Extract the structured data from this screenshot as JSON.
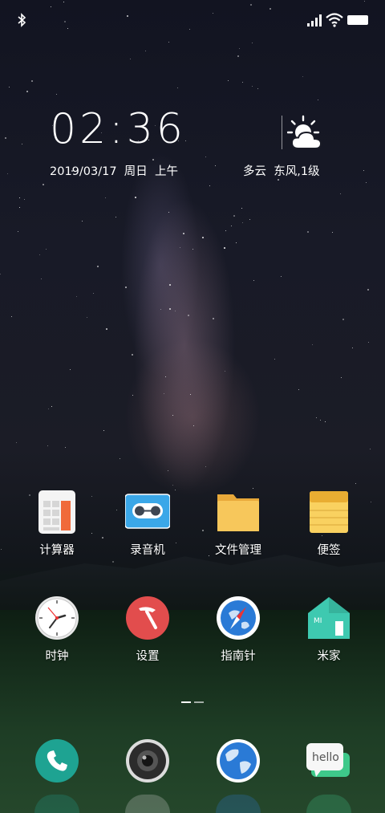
{
  "status_bar": {
    "bluetooth_icon": "bluetooth-icon",
    "signal_icon": "cell-signal-icon",
    "wifi_icon": "wifi-icon",
    "battery_icon": "battery-icon"
  },
  "clock_widget": {
    "time": "02:36",
    "date": "2019/03/17  周日  上午",
    "weather": "多云  东风,1级",
    "weather_icon": "partly-cloudy-icon"
  },
  "apps_row1": [
    {
      "label": "计算器",
      "icon": "calculator-icon"
    },
    {
      "label": "录音机",
      "icon": "recorder-icon"
    },
    {
      "label": "文件管理",
      "icon": "folder-icon"
    },
    {
      "label": "便签",
      "icon": "notes-icon"
    }
  ],
  "apps_row2": [
    {
      "label": "时钟",
      "icon": "clock-icon"
    },
    {
      "label": "设置",
      "icon": "settings-icon"
    },
    {
      "label": "指南针",
      "icon": "compass-icon"
    },
    {
      "label": "米家",
      "icon": "mi-home-icon"
    }
  ],
  "dock": [
    {
      "icon": "phone-icon"
    },
    {
      "icon": "camera-icon"
    },
    {
      "icon": "browser-icon"
    },
    {
      "icon": "messaging-icon",
      "text": "hello"
    }
  ],
  "colors": {
    "calculator_accent": "#f06a3a",
    "recorder_blue": "#3aa7e8",
    "folder_yellow": "#f7c75b",
    "settings_red": "#e24d4d",
    "phone_teal": "#1ea392",
    "mi_home_teal": "#3ec9b0"
  }
}
